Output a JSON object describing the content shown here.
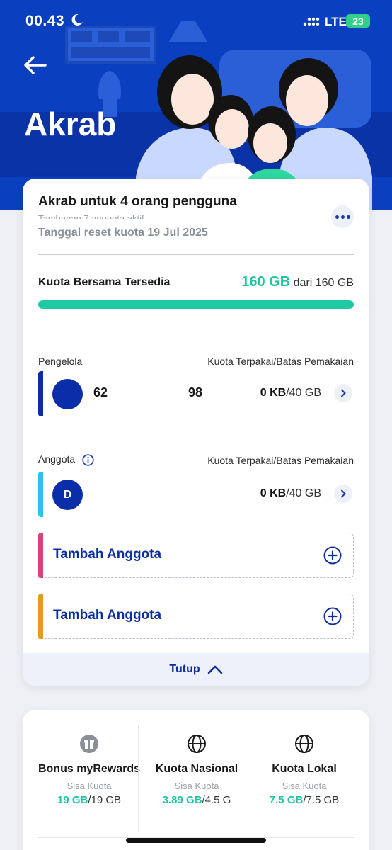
{
  "status_bar": {
    "time": "00.43",
    "network": "LTE",
    "battery": "23"
  },
  "header": {
    "title": "Akrab"
  },
  "plan": {
    "title": "Akrab untuk 4 orang pengguna",
    "subtitle_cut": "Tambahan 7 anggota aktif",
    "reset_date": "Tanggal reset kuota 19 Jul 2025",
    "shared_label": "Kuota Bersama Tersedia",
    "shared_value": "160 GB",
    "shared_total": "dari 160 GB",
    "shared_fraction": 1.0
  },
  "manager": {
    "section_label": "Pengelola",
    "right_label": "Kuota Terpakai/Batas Pemakaian",
    "num_a": "62",
    "num_b": "98",
    "used": "0 KB",
    "limit": "/40 GB",
    "color": "#0a2eaa"
  },
  "member": {
    "section_label": "Anggota",
    "right_label": "Kuota Terpakai/Batas Pemakaian",
    "avatar_initial": "D",
    "used": "0 KB",
    "limit": "/40 GB",
    "color": "#2bc3ea"
  },
  "add_slots": [
    {
      "label": "Tambah Anggota",
      "color": "#e0407a"
    },
    {
      "label": "Tambah Anggota",
      "color": "#e59b22"
    }
  ],
  "collapse": {
    "label": "Tutup"
  },
  "quota": [
    {
      "name": "Bonus myRewards",
      "icon": "gift-icon",
      "sisa_label": "Sisa Kuota",
      "value": "19 GB",
      "total": "/19 GB"
    },
    {
      "name": "Kuota Nasional",
      "icon": "globe-icon",
      "sisa_label": "Sisa Kuota",
      "value": "3.89 GB",
      "total": "/4.5 G"
    },
    {
      "name": "Kuota Lokal",
      "icon": "globe-icon",
      "sisa_label": "Sisa Kuota",
      "value": "7.5 GB",
      "total": "/7.5 GB"
    }
  ],
  "colors": {
    "brand": "#0a3fc0",
    "accent_green": "#20c5a0",
    "link": "#0d2f9e"
  }
}
